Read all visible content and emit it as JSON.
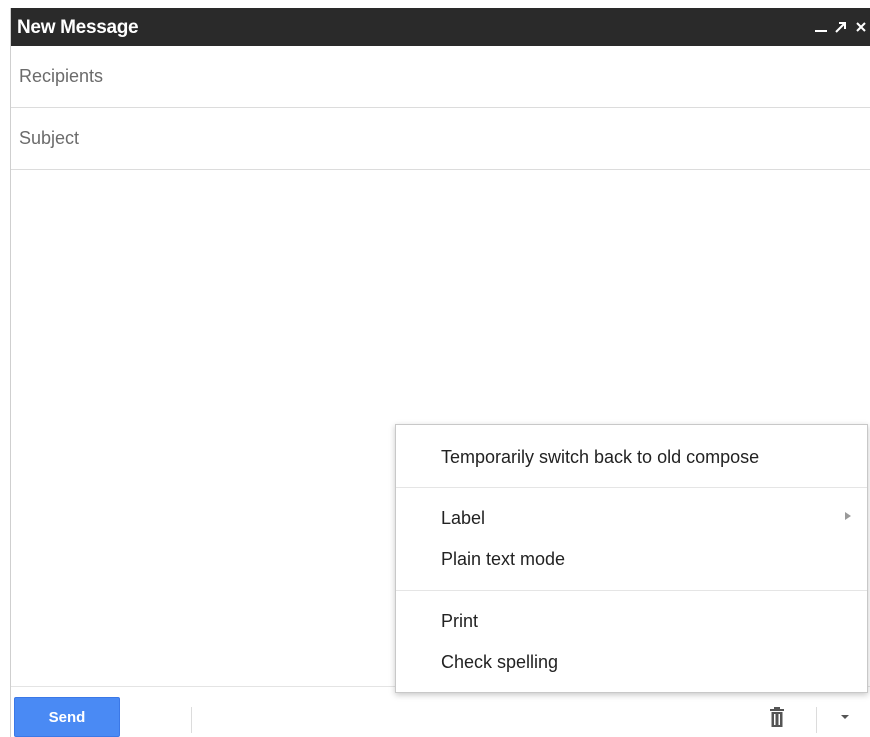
{
  "window": {
    "title": "New Message",
    "minimize_icon": "minimize-icon",
    "popout_icon": "popout-arrow-icon",
    "close_icon": "close-icon"
  },
  "fields": {
    "recipients_placeholder": "Recipients",
    "subject_placeholder": "Subject"
  },
  "menu": {
    "items": [
      {
        "label": "Temporarily switch back to old compose"
      },
      {
        "label": "Label",
        "has_submenu": true
      },
      {
        "label": "Plain text mode"
      },
      {
        "label": "Print"
      },
      {
        "label": "Check spelling"
      }
    ]
  },
  "toolbar": {
    "send_label": "Send",
    "trash_icon": "trash-icon",
    "more_icon": "more-options-arrow-icon"
  },
  "colors": {
    "titlebar": "#2a2a2a",
    "send_button": "#4a8af4"
  }
}
